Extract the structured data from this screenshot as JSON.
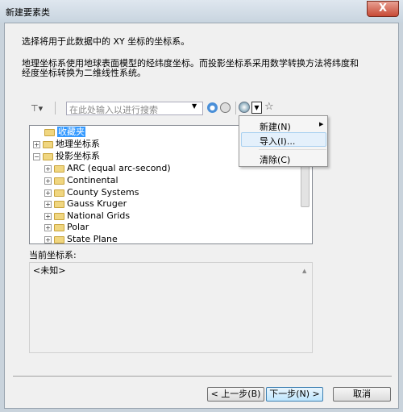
{
  "window": {
    "title": "新建要素类",
    "close_label": "X"
  },
  "instructions": {
    "line1": "选择将用于此数据中的 XY 坐标的坐标系。",
    "line2a": "地理坐标系使用地球表面模型的经纬度坐标。而投影坐标系采用数学转换方法将纬度和",
    "line2b": "经度坐标转换为二维线性系统。"
  },
  "toolbar": {
    "search_placeholder": "在此处输入以进行搜索",
    "icons": [
      "filter-icon",
      "search-icon",
      "search-clear-icon",
      "globe-add-icon",
      "dropdown-icon",
      "favorite-add-icon"
    ]
  },
  "tree": {
    "favorites": "收藏夹",
    "geographic": "地理坐标系",
    "projected": "投影坐标系",
    "children": [
      "ARC (equal arc-second)",
      "Continental",
      "County Systems",
      "Gauss Kruger",
      "National Grids",
      "Polar",
      "State Plane"
    ]
  },
  "menu": {
    "items": [
      "新建(N)",
      "导入(I)...",
      "清除(C)"
    ]
  },
  "current": {
    "label": "当前坐标系:",
    "value": "<未知>"
  },
  "buttons": {
    "back": "< 上一步(B)",
    "next": "下一步(N) >",
    "cancel": "取消"
  }
}
